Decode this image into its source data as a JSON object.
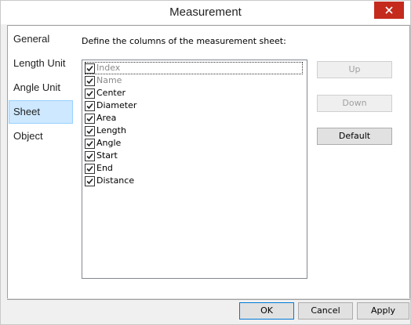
{
  "window": {
    "title": "Measurement"
  },
  "sidebar": {
    "items": [
      {
        "label": "General"
      },
      {
        "label": "Length Unit"
      },
      {
        "label": "Angle Unit"
      },
      {
        "label": "Sheet",
        "selected": true
      },
      {
        "label": "Object"
      }
    ]
  },
  "sheet": {
    "description": "Define the columns of the measurement sheet:",
    "columns": [
      {
        "label": "Index",
        "checked": true,
        "enabled": false
      },
      {
        "label": "Name",
        "checked": true,
        "enabled": false
      },
      {
        "label": "Center",
        "checked": true,
        "enabled": true
      },
      {
        "label": "Diameter",
        "checked": true,
        "enabled": true
      },
      {
        "label": "Area",
        "checked": true,
        "enabled": true
      },
      {
        "label": "Length",
        "checked": true,
        "enabled": true
      },
      {
        "label": "Angle",
        "checked": true,
        "enabled": true
      },
      {
        "label": "Start",
        "checked": true,
        "enabled": true
      },
      {
        "label": "End",
        "checked": true,
        "enabled": true
      },
      {
        "label": "Distance",
        "checked": true,
        "enabled": true
      }
    ],
    "buttons": {
      "up": "Up",
      "down": "Down",
      "default": "Default"
    }
  },
  "footer": {
    "ok": "OK",
    "cancel": "Cancel",
    "apply": "Apply"
  },
  "colors": {
    "close": "#c42b1c",
    "selection": "#cde8ff",
    "focus_border": "#0078d7"
  },
  "icons": {
    "close": "close-icon",
    "check": "check-icon"
  }
}
